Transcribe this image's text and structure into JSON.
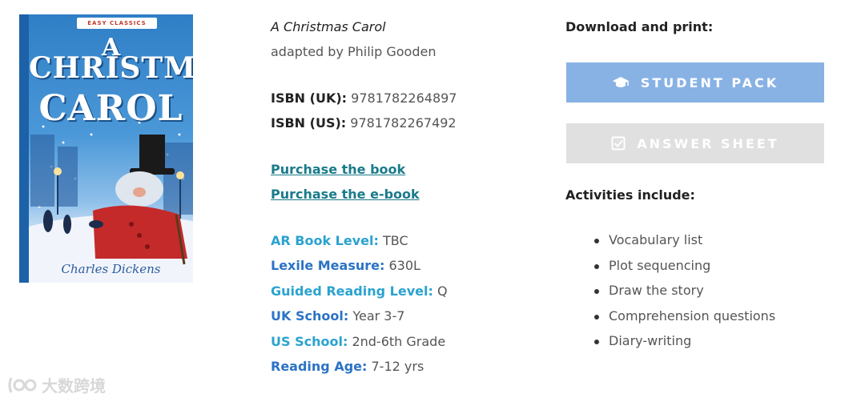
{
  "book": {
    "cover": {
      "series": "EASY CLASSICS",
      "title_lines": [
        "A",
        "CHRISTMAS",
        "CAROL"
      ],
      "author": "Charles Dickens"
    },
    "title": "A Christmas Carol",
    "adapted_by": "adapted by Philip Gooden",
    "isbn_uk_label": "ISBN (UK):",
    "isbn_uk": "9781782264897",
    "isbn_us_label": "ISBN (US):",
    "isbn_us": "9781782267492",
    "purchase_book": "Purchase the book",
    "purchase_ebook": "Purchase the e-book",
    "levels": [
      {
        "label": "AR Book Level:",
        "value": "TBC"
      },
      {
        "label": "Lexile Measure:",
        "value": "630L"
      },
      {
        "label": "Guided Reading Level:",
        "value": "Q"
      },
      {
        "label": "UK School:",
        "value": "Year 3-7"
      },
      {
        "label": "US School:",
        "value": "2nd-6th Grade"
      },
      {
        "label": "Reading Age:",
        "value": "7-12 yrs"
      }
    ]
  },
  "downloads": {
    "heading": "Download and print:",
    "student_pack": {
      "label": "STUDENT PACK",
      "icon": "graduation-cap-icon",
      "color": "#88b2e4"
    },
    "answer_sheet": {
      "label": "ANSWER SHEET",
      "icon": "checkbox-icon",
      "color": "#e0e0e0"
    }
  },
  "activities": {
    "heading": "Activities include:",
    "items": [
      "Vocabulary list",
      "Plot sequencing",
      "Draw the story",
      "Comprehension questions",
      "Diary-writing"
    ]
  },
  "watermark": {
    "text": "大数跨境"
  },
  "colors": {
    "link": "#1a7b8a",
    "level_label": "#2aa3cf",
    "level_label_alt": "#2b73c5"
  }
}
